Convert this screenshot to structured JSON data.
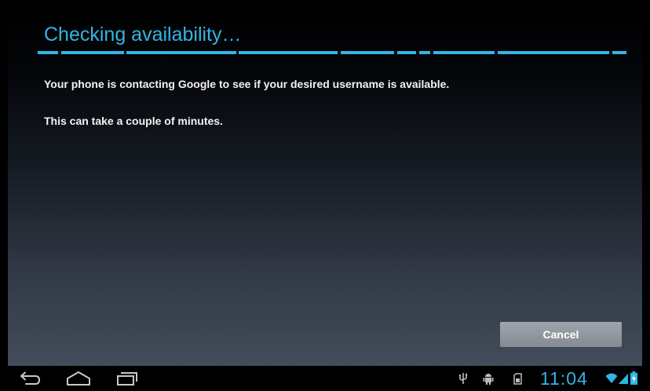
{
  "dialog": {
    "title": "Checking availability…",
    "message_primary": "Your phone is contacting Google to see if your desired username is available.",
    "message_secondary": "This can take a couple of minutes.",
    "cancel_label": "Cancel"
  },
  "status_bar": {
    "clock": "11:04",
    "icons": [
      "usb-icon",
      "android-debug-icon",
      "sd-card-icon",
      "wifi-icon",
      "signal-icon",
      "battery-icon"
    ]
  },
  "nav_bar": {
    "icons": [
      "back-icon",
      "home-icon",
      "recent-apps-icon"
    ]
  },
  "colors": {
    "accent": "#33b5e5",
    "text": "#f2f2f2",
    "button": "#8f959d"
  }
}
